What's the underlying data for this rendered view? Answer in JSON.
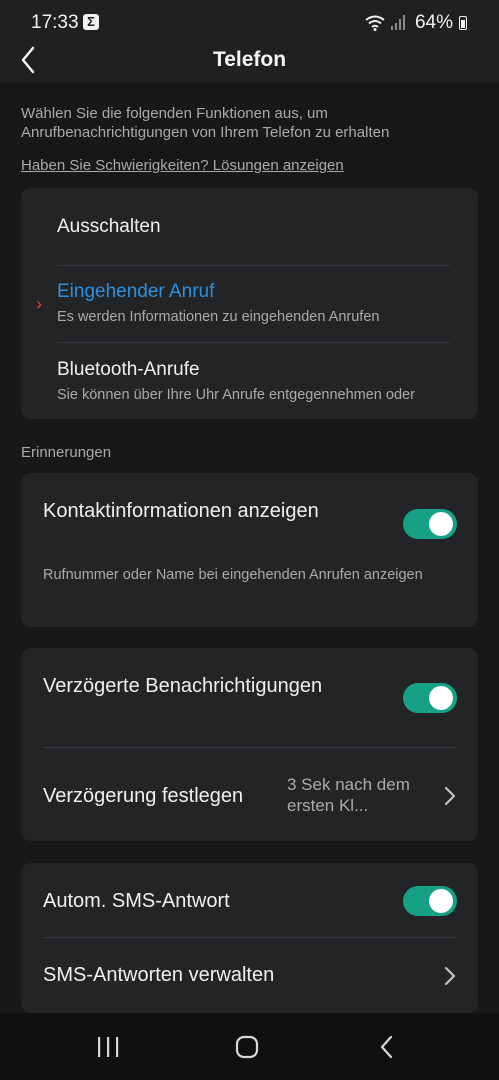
{
  "status": {
    "time": "17:33",
    "app_icon": "Σ",
    "battery": "64%"
  },
  "header": {
    "title": "Telefon"
  },
  "intro": "Wählen Sie die folgenden Funktionen aus, um Anrufbenachrichtigungen von Ihrem Telefon zu erhalten",
  "help_link": "Haben Sie Schwierigkeiten? Lösungen anzeigen",
  "modes": {
    "selected_marker": "›",
    "items": [
      {
        "title": "Ausschalten"
      },
      {
        "title": "Eingehender Anruf",
        "subtitle": "Es werden Informationen zu eingehenden Anrufen"
      },
      {
        "title": "Bluetooth-Anrufe",
        "subtitle": "Sie können über Ihre Uhr Anrufe entgegennehmen oder"
      }
    ]
  },
  "reminders": {
    "section_label": "Erinnerungen",
    "contact_info": {
      "title": "Kontaktinformationen anzeigen",
      "description": "Rufnummer oder Name bei eingehenden Anrufen anzeigen",
      "enabled": true
    },
    "delayed": {
      "title": "Verzögerte Benachrichtigungen",
      "enabled": true,
      "set_delay_label": "Verzögerung festlegen",
      "set_delay_value": "3 Sek nach dem ersten Kl..."
    },
    "sms": {
      "auto_reply_label": "Autom. SMS-Antwort",
      "enabled": true,
      "manage_label": "SMS-Antworten verwalten"
    }
  },
  "colors": {
    "accent": "#2d8fe0",
    "toggle_on": "#16a085",
    "marker": "#e8433a"
  },
  "icons": [
    "sigma-icon",
    "wifi-icon",
    "signal-icon",
    "battery-icon",
    "back-arrow-icon",
    "chevron-right-icon",
    "recents-icon",
    "home-icon",
    "nav-back-icon"
  ]
}
